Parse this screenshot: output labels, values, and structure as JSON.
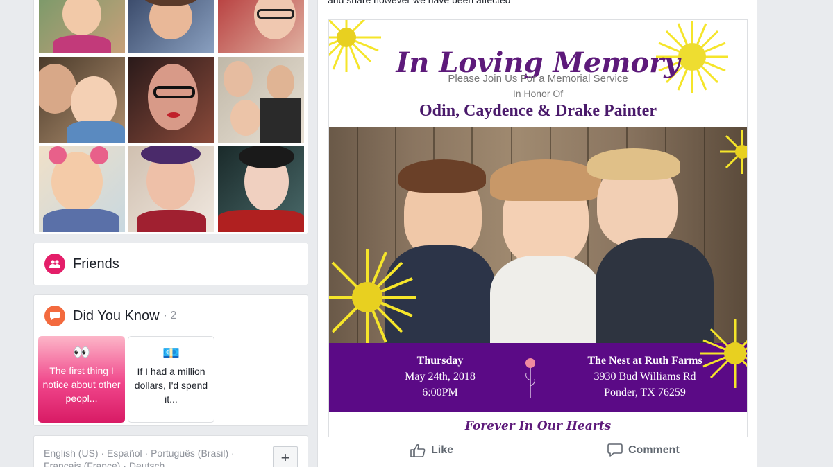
{
  "post": {
    "text_fragment": "and share however we have been affected",
    "flyer": {
      "title": "In Loving Memory",
      "subtitle_1": "Please Join Us For a Memorial Service",
      "subtitle_2": "In Honor Of",
      "names": "Odin, Caydence & Drake Painter",
      "day": "Thursday",
      "date": "May 24th, 2018",
      "time": "6:00PM",
      "venue": "The Nest at Ruth Farms",
      "address": "3930 Bud Williams Rd",
      "city": "Ponder, TX 76259",
      "footer": "Forever In Our Hearts",
      "accent_color": "#5b0a86",
      "flower_color": "#f5e52a"
    },
    "actions": {
      "like": "Like",
      "comment": "Comment"
    }
  },
  "sidebar": {
    "photos_icon_colors": [
      "#c9a07a",
      "#7a8aa0",
      "#d4a090",
      "#b08060",
      "#6a3030",
      "#8a7060",
      "#e0c0a0",
      "#704040",
      "#303030"
    ],
    "friends": {
      "title": "Friends",
      "icon": "friends-icon",
      "icon_color": "#e41e69"
    },
    "did_you_know": {
      "title": "Did You Know",
      "count": "· 2",
      "icon": "speech-bubble-icon",
      "icon_color": "#f36a3e",
      "tiles": [
        {
          "emoji": "👀",
          "text": "The first thing I notice about other peopl..."
        },
        {
          "emoji": "💶",
          "text": "If I had a million dollars, I'd spend it..."
        }
      ]
    },
    "languages": {
      "items": [
        "English (US)",
        "Español",
        "Português (Brasil)",
        "Français (France)",
        "Deutsch"
      ],
      "separator": " · ",
      "add_label": "+"
    }
  }
}
